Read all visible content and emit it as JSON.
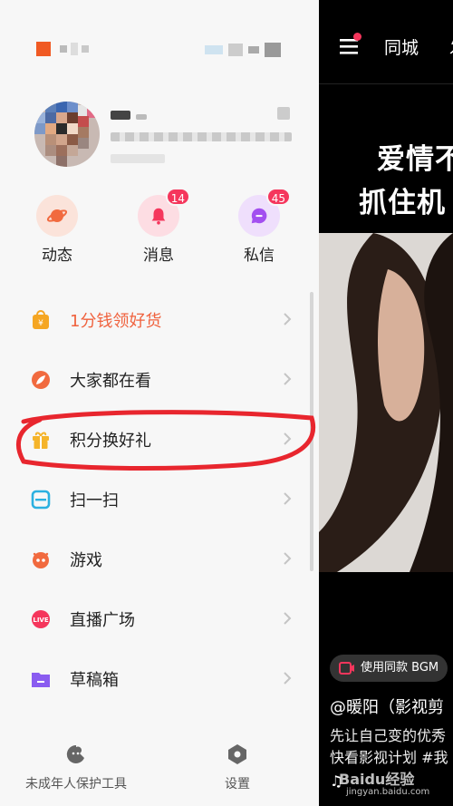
{
  "drawer": {
    "quick_actions": [
      {
        "label": "动态",
        "icon": "planet-icon",
        "color": "#f16a3f",
        "badge": ""
      },
      {
        "label": "消息",
        "icon": "bell-icon",
        "color": "#f5365c",
        "badge": "14"
      },
      {
        "label": "私信",
        "icon": "chat-bubble-icon",
        "color": "#a34ff0",
        "badge": "45"
      }
    ],
    "menu": [
      {
        "label": "1分钱领好货",
        "icon": "shopping-bag-icon",
        "color": "#f5a623",
        "highlight": true
      },
      {
        "label": "大家都在看",
        "icon": "leaf-icon",
        "color": "#f16a3f",
        "highlight": false
      },
      {
        "label": "积分换好礼",
        "icon": "gift-icon",
        "color": "#f5b42a",
        "highlight": false
      },
      {
        "label": "扫一扫",
        "icon": "scan-icon",
        "color": "#2bb0e0",
        "highlight": false
      },
      {
        "label": "游戏",
        "icon": "game-icon",
        "color": "#f16a3f",
        "highlight": false
      },
      {
        "label": "直播广场",
        "icon": "live-icon",
        "color": "#f5365c",
        "highlight": false
      },
      {
        "label": "草稿箱",
        "icon": "folder-icon",
        "color": "#8a5cf0",
        "highlight": false
      }
    ],
    "footer": {
      "youth_label": "未成年人保护工具",
      "settings_label": "设置"
    },
    "live_icon_text": "LIVE"
  },
  "feed": {
    "nav_tab_1": "同城",
    "nav_tab_2": "发",
    "overlay_line_1": "爱情不",
    "overlay_line_2": "抓住机",
    "bgm_label": "使用同款 BGM",
    "author": "@暖阳（影视剪",
    "desc_line_1": "先让自己变的优秀",
    "desc_line_2": "快看影视计划 #我",
    "music": "♫",
    "watermark": "Baidu经验",
    "watermark_sub": "jingyan.baidu.com"
  },
  "colors": {
    "drawer_bg": "#f7f7f7",
    "accent_red": "#f5365c",
    "annotation_ring": "#e8262e"
  }
}
